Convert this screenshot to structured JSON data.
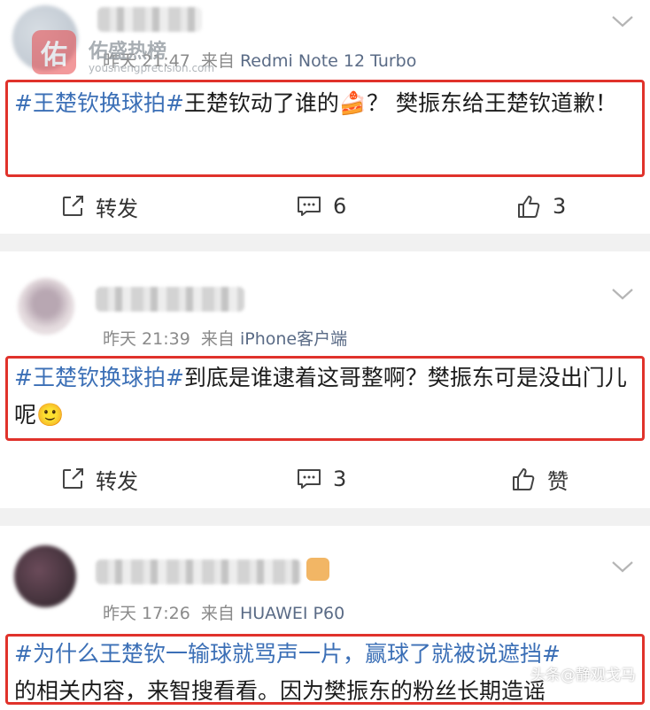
{
  "watermark": {
    "logo_char": "佑",
    "title": "佑盛热榜",
    "url": "youshengprecision.com",
    "corner": "头条@静观戈马"
  },
  "posts": [
    {
      "time": "昨天 21:47",
      "source_prefix": "来自",
      "source": "Redmi Note 12 Turbo",
      "tag": "#王楚钦换球拍#",
      "text": "王楚钦动了谁的🍰？ 樊振东给王楚钦道歉！",
      "repost_label": "转发",
      "comment_count": "6",
      "like_label": "3"
    },
    {
      "time": "昨天 21:39",
      "source_prefix": "来自",
      "source": "iPhone客户端",
      "tag": "#王楚钦换球拍#",
      "text": "到底是谁逮着这哥整啊？樊振东可是没出门儿呢🙂",
      "repost_label": "转发",
      "comment_count": "3",
      "like_label": "赞"
    },
    {
      "time": "昨天 17:26",
      "source_prefix": "来自",
      "source": "HUAWEI P60",
      "tag": "#为什么王楚钦一输球就骂声一片，赢球了就被说遮挡#",
      "text": "的相关内容，来智搜看看。因为樊振东的粉丝长期造谣"
    }
  ]
}
